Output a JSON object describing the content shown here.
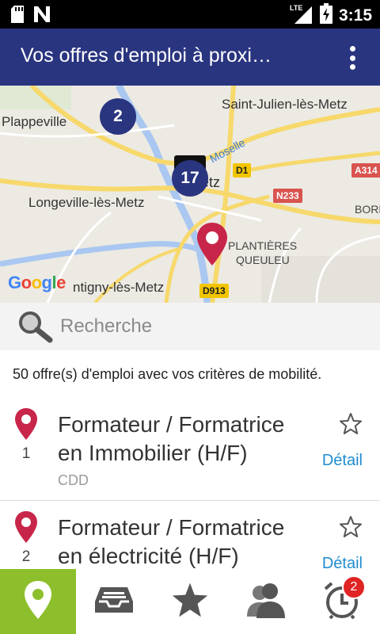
{
  "status_bar": {
    "left_icons": [
      "sd-card-icon",
      "n-notification-icon"
    ],
    "network": "LTE",
    "time": "3:15"
  },
  "appbar": {
    "title": "Vos offres d'emploi à proxi…",
    "menu_icon": "overflow-menu-icon"
  },
  "map": {
    "places": {
      "plappeville": "Plappeville",
      "saint_julien": "Saint-Julien-lès-Metz",
      "longeville": "Longeville-lès-Metz",
      "metz": "etz",
      "plantieres": "PLANTIÈRES",
      "queuleu": "QUEULEU",
      "montigny": "ntigny-lès-Metz",
      "borny": "BORN",
      "moselle": "Moselle"
    },
    "roads": {
      "a314": "A314",
      "d1": "D1",
      "n233": "N233",
      "d913": "D913"
    },
    "clusters": {
      "c1": "2",
      "c2": "17"
    },
    "logo": "Google"
  },
  "search": {
    "placeholder": "Recherche"
  },
  "summary": "50 offre(s) d'emploi avec vos critères de mobilité.",
  "jobs": [
    {
      "number": "1",
      "title": "Formateur / Formatrice en Immobilier (H/F)",
      "type": "CDD",
      "detail": "Détail"
    },
    {
      "number": "2",
      "title": "Formateur / Formatrice en électricité (H/F)",
      "type": "",
      "detail": "Détail"
    }
  ],
  "bottom_nav": {
    "tabs": [
      "map-pin-icon",
      "inbox-icon",
      "star-icon",
      "contacts-icon",
      "alarm-clock-icon"
    ],
    "alarm_badge": "2"
  },
  "colors": {
    "appbar": "#2a3580",
    "active_tab": "#8cbf2b",
    "pin": "#c8254a",
    "link": "#1e8ccf",
    "badge": "#e02424"
  }
}
